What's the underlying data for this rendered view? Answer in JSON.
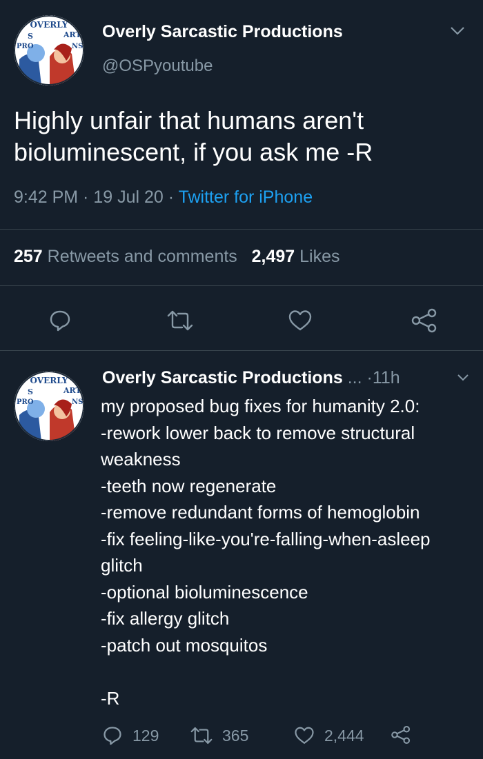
{
  "main_tweet": {
    "author_name": "Overly Sarcastic Productions",
    "handle": "@OSPyoutube",
    "text_lines": [
      "Highly unfair that humans aren't",
      "bioluminescent, if you ask me -R"
    ],
    "time": "9:42 PM",
    "date": "19 Jul 20",
    "source": "Twitter for iPhone",
    "separator": " · ",
    "retweets_count": "257",
    "retweets_label": "Retweets and comments",
    "likes_count": "2,497",
    "likes_label": "Likes",
    "actions": [
      "reply-icon",
      "retweet-icon",
      "like-icon",
      "share-icon"
    ]
  },
  "reply_tweet": {
    "author_name": "Overly Sarcastic Productions",
    "truncation": "...",
    "age": "11h",
    "dot": "·",
    "lines": [
      "my proposed bug fixes for humanity 2.0:",
      "-rework lower back to remove structural",
      "weakness",
      "-teeth now regenerate",
      "-remove redundant forms of hemoglobin",
      "-fix feeling-like-you're-falling-when-asleep",
      "glitch",
      "-optional bioluminescence",
      "-fix allergy glitch",
      "-patch out mosquitos",
      "",
      "-R"
    ],
    "reply_count": "129",
    "retweet_count": "365",
    "like_count": "2,444"
  },
  "colors": {
    "background": "#151f2b",
    "text": "#ffffff",
    "secondary": "#8899a6",
    "link": "#1da1f2",
    "divider": "#38444d"
  }
}
